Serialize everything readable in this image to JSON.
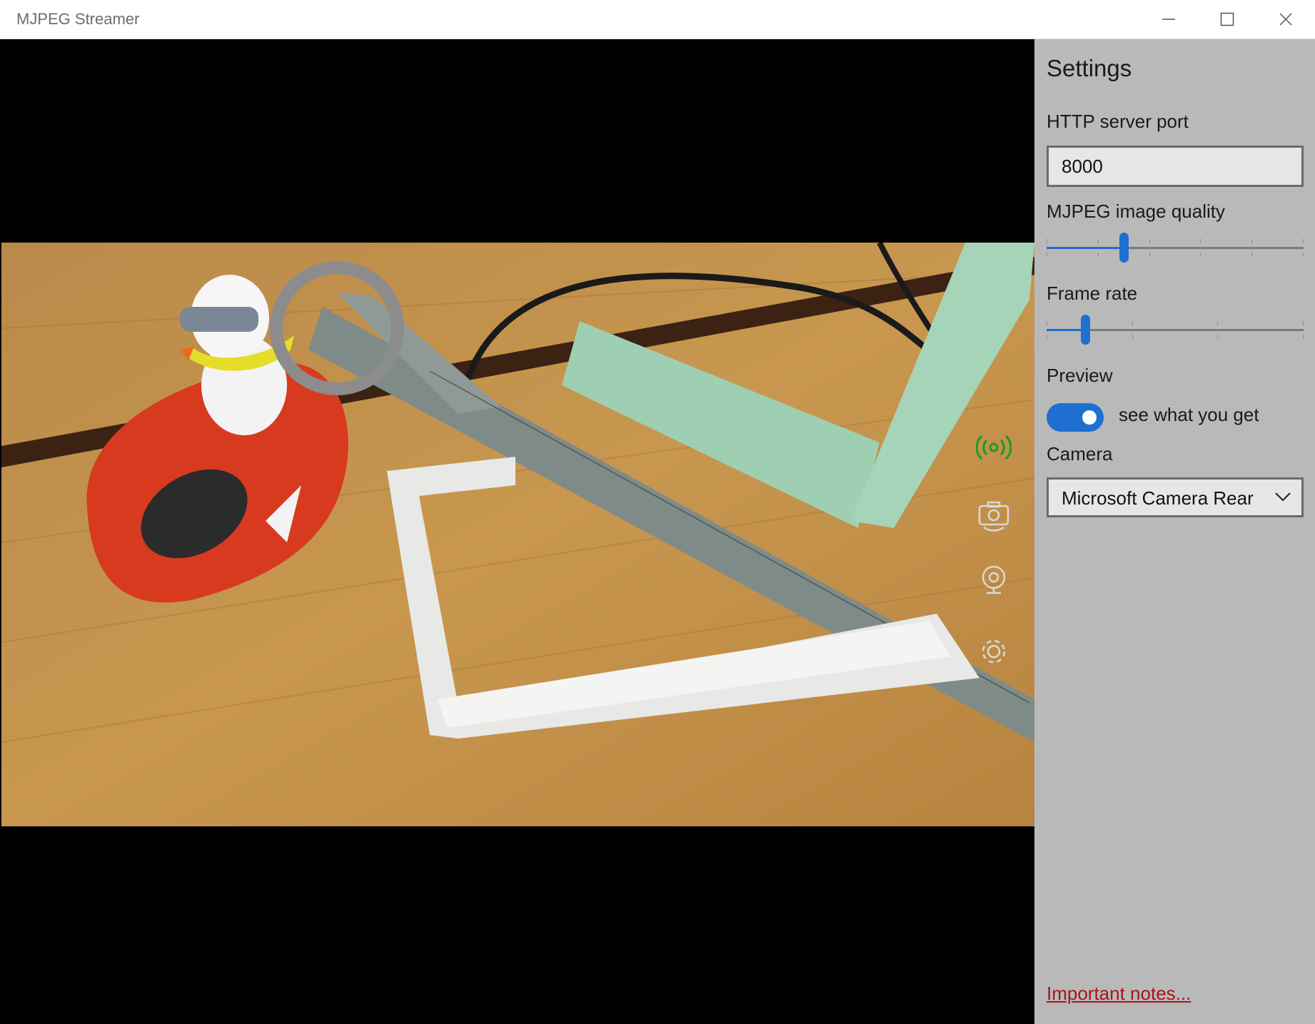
{
  "window": {
    "title": "MJPEG Streamer",
    "controls": [
      "minimize-icon",
      "maximize-icon",
      "close-icon"
    ]
  },
  "overlay_icons": [
    {
      "name": "broadcast-icon",
      "color": "#1d9a2a"
    },
    {
      "name": "switch-camera-icon",
      "color": "#d9d9d9"
    },
    {
      "name": "webcam-icon",
      "color": "#d9d9d9"
    },
    {
      "name": "gear-icon",
      "color": "#d9d9d9"
    }
  ],
  "settings": {
    "heading": "Settings",
    "port_label": "HTTP server port",
    "port_value": "8000",
    "quality_label": "MJPEG image quality",
    "quality_value_fraction": 0.3,
    "framerate_label": "Frame rate",
    "framerate_value_fraction": 0.15,
    "preview_label": "Preview",
    "preview_on": true,
    "preview_toggle_text": "see what you get",
    "camera_label": "Camera",
    "camera_selected": "Microsoft Camera Rear",
    "notes_link": "Important notes..."
  },
  "colors": {
    "accent": "#1e6fd0",
    "panel_bg": "#b9b9b9",
    "link": "#a4161a",
    "active_icon": "#1d9a2a"
  }
}
